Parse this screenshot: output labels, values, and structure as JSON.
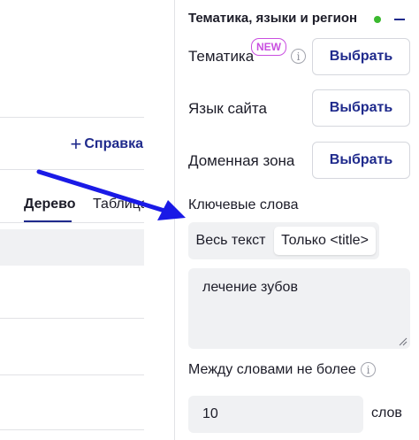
{
  "left_panel": {
    "help_link": {
      "plus": "+",
      "label": "Справка"
    },
    "tabs": [
      {
        "label": "Дерево",
        "active": true
      },
      {
        "label": "Таблица",
        "active": false
      }
    ]
  },
  "section": {
    "title": "Тематика, языки и регион",
    "status_color": "#3bb92f",
    "collapse_icon": "minus-icon"
  },
  "rows": [
    {
      "label": "Тематика",
      "badge": "NEW",
      "info": "i",
      "button": "Выбрать"
    },
    {
      "label": "Язык сайта",
      "button": "Выбрать"
    },
    {
      "label": "Доменная зона",
      "button": "Выбрать"
    }
  ],
  "keywords": {
    "label": "Ключевые слова",
    "modes": [
      {
        "label": "Весь текст",
        "selected": false
      },
      {
        "label": "Только <title>",
        "selected": true
      }
    ],
    "value": "лечение зубов"
  },
  "between_words": {
    "label": "Между словами не более",
    "info": "i",
    "value": "10",
    "unit": "слов"
  },
  "colors": {
    "accent": "#1f2a8c",
    "badge": "#c94fe0",
    "annotation_arrow": "#1a1ae6",
    "field_bg": "#f0f1f3"
  }
}
